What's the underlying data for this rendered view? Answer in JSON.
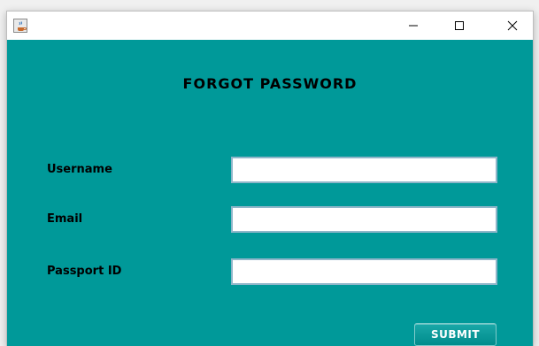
{
  "window": {
    "app_icon": "java-coffee-cup-icon",
    "controls": {
      "minimize_icon": "minimize-icon",
      "maximize_icon": "maximize-icon",
      "close_icon": "close-icon"
    }
  },
  "form": {
    "heading": "FORGOT PASSWORD",
    "fields": [
      {
        "label": "Username",
        "value": ""
      },
      {
        "label": "Email",
        "value": ""
      },
      {
        "label": "Passport ID",
        "value": ""
      }
    ],
    "submit_label": "SUBMIT"
  },
  "colors": {
    "background": "#009999",
    "titlebar": "#ffffff",
    "input_border": "#8fb6c9"
  }
}
